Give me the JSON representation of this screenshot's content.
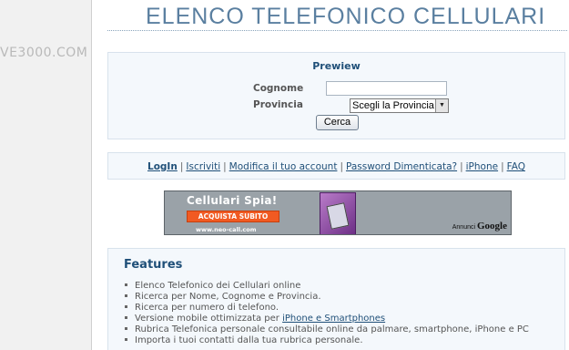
{
  "sidebar": {
    "logo_text": "VE3000.COM"
  },
  "header": {
    "title": "ELENCO TELEFONICO CELLULARI"
  },
  "search_form": {
    "title": "Prewiew",
    "cognome_label": "Cognome",
    "cognome_value": "",
    "provincia_label": "Provincia",
    "provincia_selected": "Scegli la Provincia",
    "submit_label": "Cerca"
  },
  "nav": {
    "links": [
      "LogIn",
      "Iscriviti",
      "Modifica il tuo account",
      "Password Dimenticata?",
      "iPhone",
      "FAQ"
    ],
    "separator": "|"
  },
  "ad": {
    "title": "Cellulari Spia!",
    "cta": "ACQUISTA SUBITO",
    "url": "www.neo-call.com",
    "annunci": "Annunci",
    "google": "Google"
  },
  "features": {
    "title": "Features",
    "items": [
      "Elenco Telefonico dei Cellulari online",
      "Ricerca per Nome, Cognome e Provincia.",
      "Ricerca per numero di telefono.",
      "Versione mobile ottimizzata per ",
      "Rubrica Telefonica personale consultabile online da palmare, smartphone, iPhone e PC",
      "Importa i tuoi contatti dalla tua rubrica personale."
    ],
    "item4_link": "iPhone e Smartphones"
  }
}
